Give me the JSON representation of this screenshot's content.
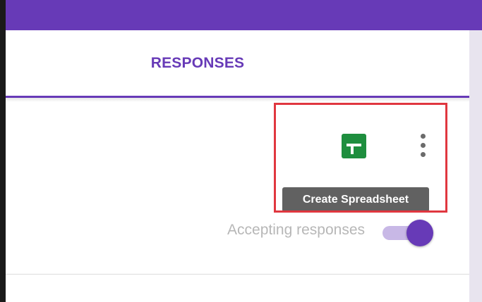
{
  "tabs": {
    "active_label": "RESPONSES"
  },
  "toolbar": {
    "sheets_icon": "google-sheets-icon",
    "more_icon": "more-vert-icon",
    "tooltip": "Create Spreadsheet"
  },
  "responses": {
    "accepting_label": "Accepting responses",
    "accepting_on": true
  },
  "colors": {
    "accent": "#673ab7",
    "sheets_green": "#1e8e3e",
    "highlight_red": "#e0373f",
    "tooltip_bg": "#616161"
  }
}
